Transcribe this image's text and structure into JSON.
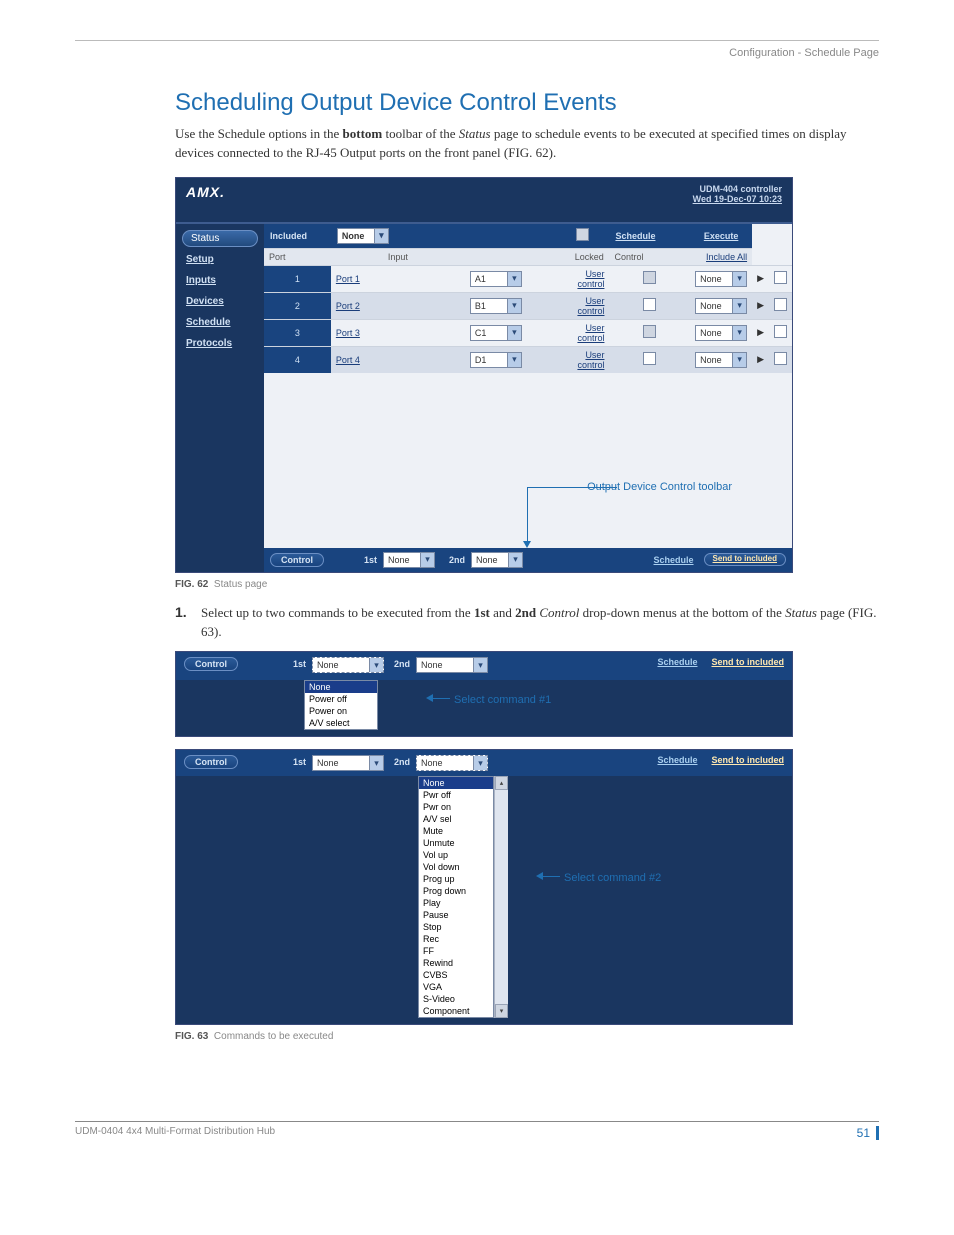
{
  "breadcrumb": "Configuration - Schedule Page",
  "title": "Scheduling Output Device Control Events",
  "intro_parts": {
    "pre": "Use the Schedule options in the ",
    "bold1": "bottom",
    "mid1": " toolbar of the ",
    "ital1": "Status",
    "post": " page to schedule events to be executed at specified times on display devices connected to the RJ-45 Output ports on the front panel (FIG. 62)."
  },
  "amx": {
    "logo": "AMX",
    "controller": "UDM-404 controller",
    "datetime": "Wed 19-Dec-07 10:23",
    "sidebar": [
      "Status",
      "Setup",
      "Inputs",
      "Devices",
      "Schedule",
      "Protocols"
    ],
    "headers": {
      "included": "Included",
      "input_sel": "None",
      "schedule": "Schedule",
      "execute": "Execute"
    },
    "sub": {
      "port": "Port",
      "input": "Input",
      "locked": "Locked",
      "control": "Control",
      "include": "Include All"
    },
    "rows": [
      {
        "n": "1",
        "port": "Port 1",
        "inp": "A1",
        "uc": "User control",
        "ctrl": "None"
      },
      {
        "n": "2",
        "port": "Port 2",
        "inp": "B1",
        "uc": "User control",
        "ctrl": "None"
      },
      {
        "n": "3",
        "port": "Port 3",
        "inp": "C1",
        "uc": "User control",
        "ctrl": "None"
      },
      {
        "n": "4",
        "port": "Port 4",
        "inp": "D1",
        "uc": "User control",
        "ctrl": "None"
      }
    ],
    "callout": "Output Device Control toolbar",
    "bar": {
      "control": "Control",
      "first": "1st",
      "first_val": "None",
      "second": "2nd",
      "second_val": "None",
      "schedule": "Schedule",
      "send": "Send to included"
    }
  },
  "fig62_label": "FIG. 62",
  "fig62_text": "Status page",
  "step1_num": "1.",
  "step1": {
    "a": "Select up to two commands to be executed from the ",
    "b": "1st",
    "c": " and ",
    "d": "2nd",
    "e": " ",
    "f": "Control",
    "g": " drop-down menus at the bottom of the ",
    "h": "Status",
    "i": " page (FIG. 63)."
  },
  "strip1": {
    "control": "Control",
    "first": "1st",
    "second": "2nd",
    "v1": "None",
    "v2": "None",
    "schedule": "Schedule",
    "send": "Send to included",
    "opts": [
      "None",
      "Power off",
      "Power on",
      "A/V select"
    ],
    "callout": "Select command #1"
  },
  "strip2": {
    "control": "Control",
    "first": "1st",
    "second": "2nd",
    "v1": "None",
    "v2": "None",
    "schedule": "Schedule",
    "send": "Send to included",
    "opts": [
      "None",
      "Pwr off",
      "Pwr on",
      "A/V sel",
      "Mute",
      "Unmute",
      "Vol up",
      "Vol down",
      "Prog up",
      "Prog down",
      "Play",
      "Pause",
      "Stop",
      "Rec",
      "FF",
      "Rewind",
      "CVBS",
      "VGA",
      "S-Video",
      "Component"
    ],
    "callout": "Select command #2"
  },
  "fig63_label": "FIG. 63",
  "fig63_text": "Commands to be executed",
  "footer_left": "UDM-0404 4x4 Multi-Format Distribution Hub",
  "footer_page": "51"
}
